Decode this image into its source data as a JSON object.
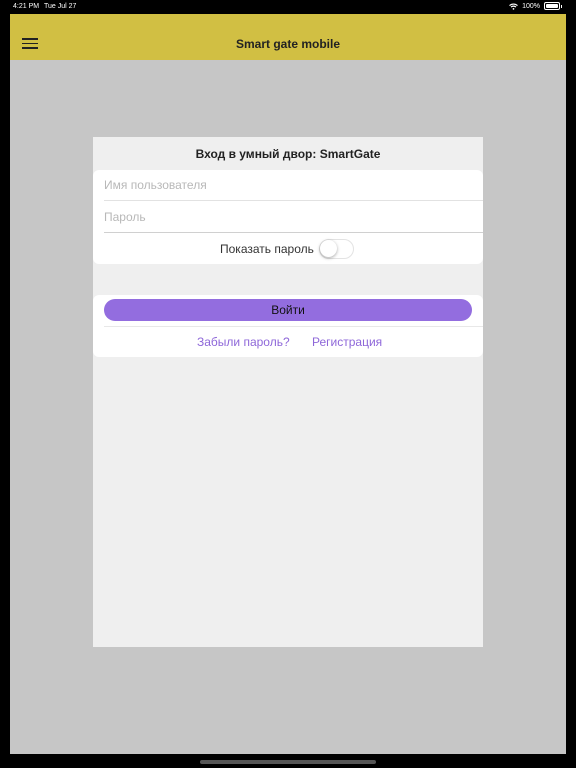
{
  "status_bar": {
    "time": "4:21 PM",
    "date": "Tue Jul 27",
    "battery": "100%",
    "icons": [
      "wifi-icon",
      "battery-icon"
    ]
  },
  "navbar": {
    "title": "Smart gate mobile",
    "menu_icon": "hamburger-menu-icon",
    "background_color": "#d1bf43"
  },
  "login": {
    "title": "Вход в умный двор: SmartGate",
    "username": {
      "value": "",
      "placeholder": "Имя пользователя"
    },
    "password": {
      "value": "",
      "placeholder": "Пароль"
    },
    "show_password": {
      "label": "Показать пароль",
      "checked": false
    },
    "submit_label": "Войти",
    "forgot_label": "Забыли пароль?",
    "register_label": "Регистрация",
    "accent_color": "#936ddf"
  }
}
